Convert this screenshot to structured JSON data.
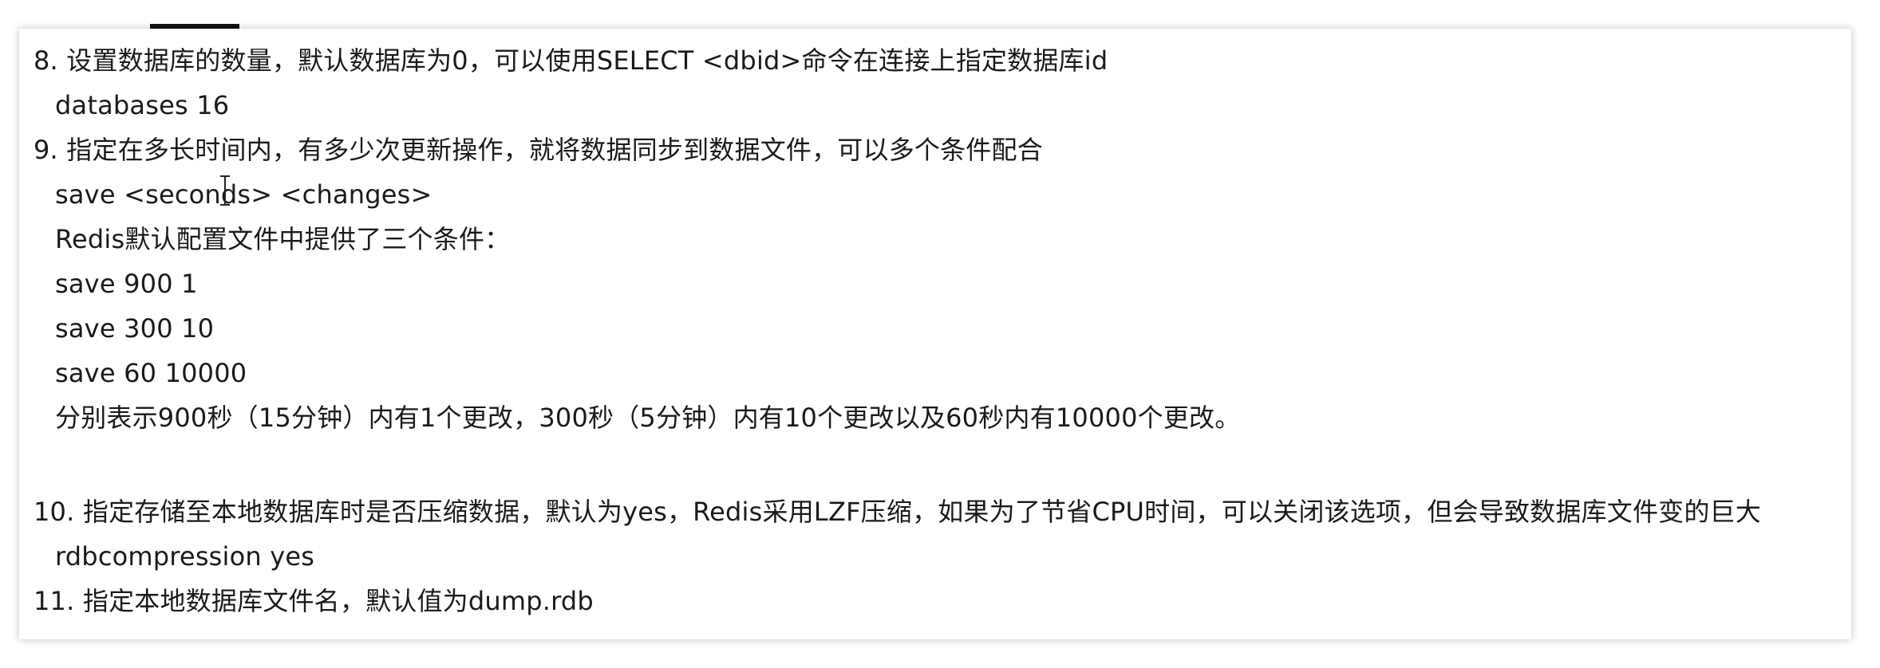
{
  "document": {
    "lines": [
      "8. 设置数据库的数量，默认数据库为0，可以使用SELECT <dbid>命令在连接上指定数据库id",
      "databases 16",
      "9. 指定在多长时间内，有多少次更新操作，就将数据同步到数据文件，可以多个条件配合",
      "save <seconds> <changes>",
      "Redis默认配置文件中提供了三个条件：",
      "save 900 1",
      "save 300 10",
      "save 60 10000",
      "分别表示900秒（15分钟）内有1个更改，300秒（5分钟）内有10个更改以及60秒内有10000个更改。",
      "10. 指定存储至本地数据库时是否压缩数据，默认为yes，Redis采用LZF压缩，如果为了节省CPU时间，可以关闭该选项，但会导致数据库文件变的巨大",
      "rdbcompression yes",
      "11. 指定本地数据库文件名，默认值为dump.rdb"
    ]
  },
  "cursor": {
    "icon": "text-cursor-icon"
  }
}
